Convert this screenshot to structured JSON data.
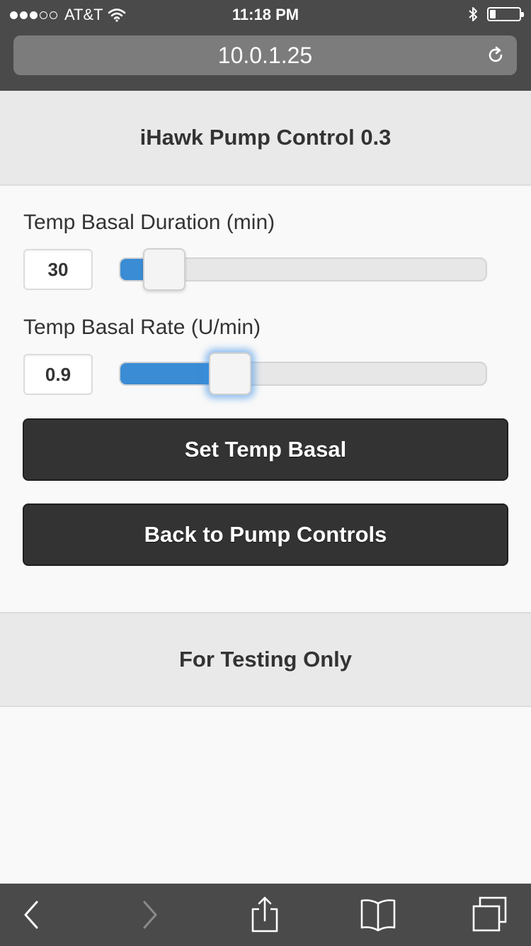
{
  "status_bar": {
    "carrier": "AT&T",
    "time": "11:18 PM",
    "signal_dots_filled": 3,
    "signal_dots_total": 5,
    "battery_level": 0.2
  },
  "browser": {
    "url": "10.0.1.25",
    "icons": {
      "reload": "reload-icon",
      "back": "back-icon",
      "forward": "forward-icon",
      "share": "share-icon",
      "bookmarks": "bookmarks-icon",
      "tabs": "tabs-icon"
    }
  },
  "page": {
    "title": "iHawk Pump Control 0.3",
    "duration": {
      "label": "Temp Basal Duration (min)",
      "value": "30",
      "fill_fraction": 0.12
    },
    "rate": {
      "label": "Temp Basal Rate (U/min)",
      "value": "0.9",
      "fill_fraction": 0.3
    },
    "set_button": "Set Temp Basal",
    "back_button": "Back to Pump Controls",
    "footer": "For Testing Only"
  },
  "colors": {
    "accent": "#3a8cd4",
    "button_bg": "#333333",
    "chrome_bg": "#4a4a4a"
  }
}
